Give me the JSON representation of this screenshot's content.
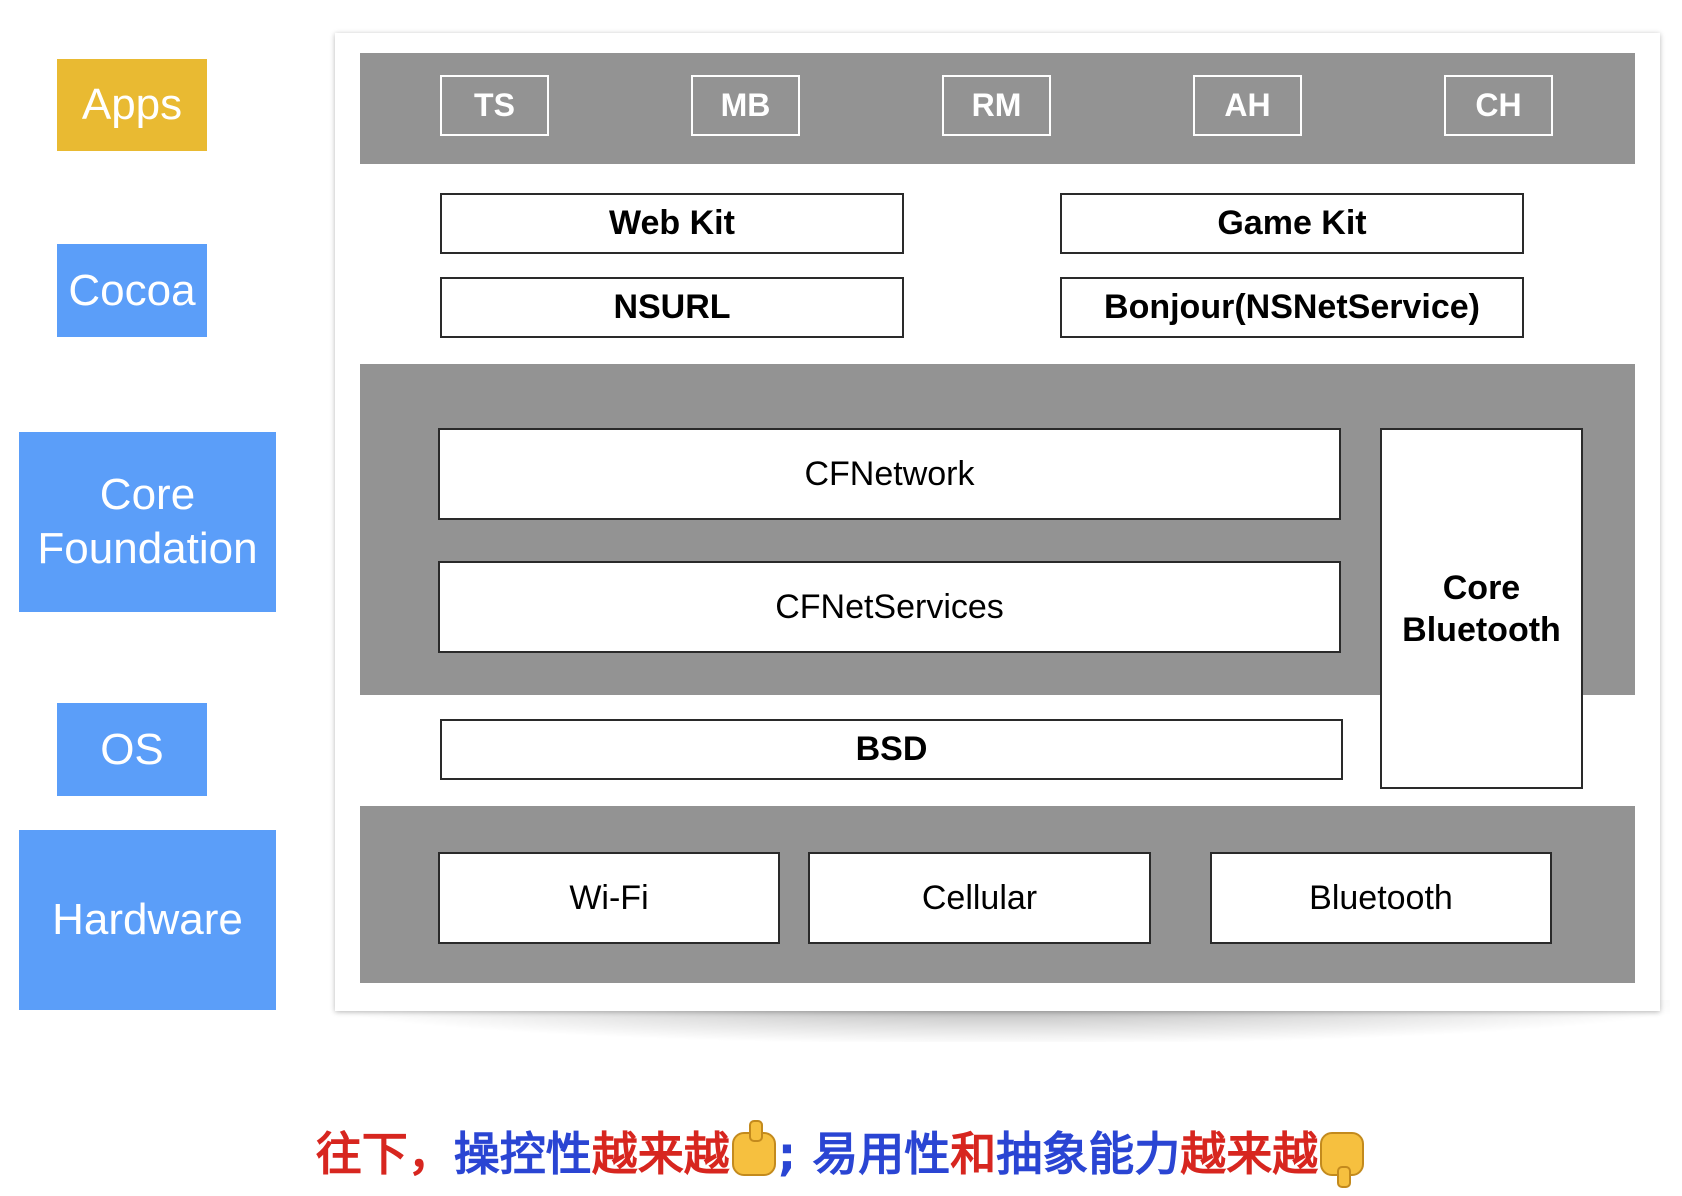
{
  "side_labels": {
    "apps": "Apps",
    "cocoa": "Cocoa",
    "core_foundation": "Core\nFoundation",
    "os": "OS",
    "hardware": "Hardware"
  },
  "apps_row": [
    "TS",
    "MB",
    "RM",
    "AH",
    "CH"
  ],
  "cocoa_layer": {
    "web_kit": "Web Kit",
    "game_kit": "Game Kit",
    "nsurl": "NSURL",
    "bonjour": "Bonjour(NSNetService)"
  },
  "core_foundation_layer": {
    "cfnetwork": "CFNetwork",
    "cfnetservices": "CFNetServices",
    "core_bluetooth": "Core\nBluetooth"
  },
  "os_layer": {
    "bsd": "BSD"
  },
  "hardware_layer": {
    "wifi": "Wi-Fi",
    "cellular": "Cellular",
    "bluetooth": "Bluetooth"
  },
  "caption": {
    "part1": "往下，",
    "part2": "操控性",
    "part3": "越来越",
    "part4": "; 易用性",
    "part5": "和",
    "part6": "抽象能力",
    "part7": "越来越"
  },
  "colors": {
    "apps_label_bg": "#e9ba32",
    "layer_label_bg": "#5b9ef9",
    "band_gray": "#939393",
    "caption_red": "#d7261f",
    "caption_blue": "#2a45d3"
  },
  "icons": {
    "positive": "thumbs-up-icon",
    "negative": "thumbs-down-icon"
  }
}
